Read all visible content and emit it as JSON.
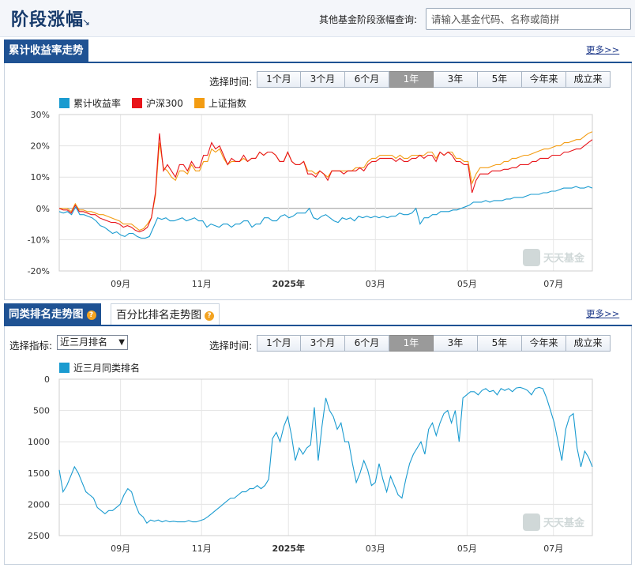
{
  "header": {
    "title": "阶段涨幅",
    "arrow": "↘",
    "search_label": "其他基金阶段涨幅查询:",
    "search_placeholder": "请输入基金代码、名称或简拼"
  },
  "section1": {
    "title": "累计收益率走势",
    "more": "更多>>",
    "range_label": "选择时间:",
    "ranges": [
      "1个月",
      "3个月",
      "6个月",
      "1年",
      "3年",
      "5年",
      "今年来",
      "成立来"
    ],
    "active_range": "1年",
    "legend": [
      {
        "name": "累计收益率",
        "color": "#1a9bd0"
      },
      {
        "name": "沪深300",
        "color": "#e8141a"
      },
      {
        "name": "上证指数",
        "color": "#f39c12"
      }
    ],
    "watermark": "天天基金"
  },
  "section2": {
    "tab_active": "同类排名走势图",
    "tab_inactive": "百分比排名走势图",
    "more": "更多>>",
    "indicator_label": "选择指标:",
    "indicator_value": "近三月排名",
    "range_label": "选择时间:",
    "ranges": [
      "1个月",
      "3个月",
      "6个月",
      "1年",
      "3年",
      "5年",
      "今年来",
      "成立来"
    ],
    "active_range": "1年",
    "legend": [
      {
        "name": "近三月同类排名",
        "color": "#1a9bd0"
      }
    ],
    "watermark": "天天基金"
  },
  "chart_data": [
    {
      "type": "line",
      "x_ticks": [
        "09月",
        "11月",
        "2025年",
        "03月",
        "05月",
        "07月"
      ],
      "ylim": [
        -20,
        30
      ],
      "y_ticks": [
        "30%",
        "20%",
        "10%",
        "0%",
        "-10%",
        "-20%"
      ],
      "series": [
        {
          "name": "累计收益率",
          "color": "#1a9bd0",
          "values": [
            -1,
            -1.5,
            -1,
            -2,
            0.5,
            -2,
            -2,
            -2.5,
            -3,
            -4,
            -5.5,
            -6,
            -7,
            -8,
            -7.5,
            -8.5,
            -9,
            -8,
            -8,
            -9,
            -9.5,
            -9.5,
            -9,
            -6,
            -3,
            -3.5,
            -3,
            -4,
            -4,
            -3.5,
            -3,
            -4,
            -3.5,
            -3,
            -4,
            -4,
            -6,
            -5,
            -5.5,
            -6,
            -5,
            -5,
            -6,
            -5,
            -5,
            -4,
            -4,
            -6,
            -5,
            -5,
            -3,
            -3,
            -4,
            -4,
            -2.5,
            -2,
            -3,
            -2.5,
            -1.5,
            -1.5,
            -1.5,
            0,
            -3,
            -3.5,
            -2.5,
            -2,
            -3,
            -4,
            -4.5,
            -3,
            -3.5,
            -3,
            -4,
            -2.5,
            -3,
            -2.5,
            -3,
            -2.5,
            -3,
            -2.5,
            -3,
            -2.5,
            -2.5,
            -1.5,
            -2,
            -2,
            -1.5,
            0,
            -5,
            -3,
            -3,
            -2,
            -2,
            -1,
            -1,
            -1,
            -0.5,
            -0.5,
            0,
            0.5,
            1,
            2,
            2,
            2,
            2.5,
            2,
            2.5,
            2.5,
            2.5,
            3,
            3,
            3.5,
            3.5,
            3.5,
            4,
            4.5,
            4.5,
            4.5,
            5,
            5,
            5.5,
            5.5,
            6,
            6.5,
            6.5,
            6.5,
            7,
            6.5,
            6.5,
            7,
            6.5
          ]
        },
        {
          "name": "沪深300",
          "color": "#e8141a",
          "values": [
            0,
            -0.5,
            -0.5,
            -1.5,
            1,
            -1,
            -1,
            -1.5,
            -2,
            -2,
            -3,
            -3.5,
            -4,
            -4.5,
            -4.5,
            -5,
            -6,
            -5.5,
            -6,
            -7,
            -7.5,
            -7,
            -6,
            -3,
            5,
            24,
            12,
            14,
            12,
            10,
            14,
            14,
            12,
            15,
            13,
            13,
            17,
            17,
            21,
            19,
            20,
            17,
            14,
            16,
            15,
            15,
            17,
            15,
            16,
            16,
            18,
            17,
            18,
            18,
            17,
            15,
            15,
            18,
            15,
            14,
            14,
            15,
            11,
            11,
            10,
            12,
            11,
            9,
            12,
            12,
            12,
            11,
            12,
            12,
            12,
            13,
            12,
            14,
            15,
            15,
            16,
            16,
            16,
            16,
            15,
            16,
            15,
            15,
            16,
            16,
            17,
            16,
            17,
            17,
            15,
            18,
            17,
            18,
            17,
            15,
            15,
            14,
            14,
            5,
            9,
            11,
            11,
            11,
            12,
            12,
            12,
            12.5,
            12.5,
            13,
            13,
            14,
            14,
            14,
            15,
            15,
            16,
            16,
            16,
            17,
            17,
            17,
            18,
            18,
            18.5,
            19,
            19,
            20,
            21,
            22
          ]
        },
        {
          "name": "上证指数",
          "color": "#f39c12",
          "values": [
            0,
            0,
            0,
            -1,
            1.5,
            -0.5,
            -0.5,
            -1,
            -1,
            -1.5,
            -2,
            -2,
            -2.5,
            -3,
            -3.5,
            -4,
            -5,
            -5,
            -5,
            -6,
            -7,
            -6.5,
            -5,
            -3,
            4,
            21,
            13,
            12,
            10,
            9,
            12,
            12,
            11,
            14,
            12,
            12,
            15,
            15,
            19,
            18,
            19,
            16,
            14,
            15,
            15,
            15,
            16,
            15,
            16,
            16,
            18,
            17,
            18,
            18,
            17,
            15,
            15,
            18,
            15,
            14,
            14,
            15,
            12,
            12,
            11,
            12,
            11,
            10,
            12,
            12,
            12,
            12,
            12,
            12,
            13,
            13,
            13,
            15,
            16,
            16,
            17,
            17,
            17,
            17,
            16,
            17,
            16,
            16,
            17,
            17,
            17,
            17,
            18,
            18,
            16,
            18,
            17,
            18,
            18,
            16,
            16,
            15,
            15,
            8,
            11,
            13,
            13,
            13,
            13.5,
            14,
            14,
            15,
            15,
            16,
            16,
            16.5,
            17,
            17,
            17.5,
            18,
            18.5,
            19,
            19,
            19.5,
            20,
            20,
            21,
            21,
            21.5,
            22,
            22,
            23,
            24,
            24.5
          ]
        }
      ]
    },
    {
      "type": "line",
      "x_ticks": [
        "09月",
        "11月",
        "2025年",
        "03月",
        "05月",
        "07月"
      ],
      "ylim": [
        0,
        2500
      ],
      "y_reversed": true,
      "y_ticks": [
        "0",
        "500",
        "1000",
        "1500",
        "2000",
        "2500"
      ],
      "series": [
        {
          "name": "近三月同类排名",
          "color": "#1a9bd0",
          "values": [
            1450,
            1800,
            1700,
            1550,
            1400,
            1500,
            1650,
            1800,
            1850,
            1900,
            2050,
            2100,
            2150,
            2100,
            2100,
            2050,
            2000,
            1850,
            1750,
            1800,
            2000,
            2150,
            2200,
            2300,
            2250,
            2270,
            2250,
            2280,
            2260,
            2280,
            2270,
            2280,
            2280,
            2280,
            2260,
            2280,
            2280,
            2260,
            2240,
            2200,
            2150,
            2100,
            2050,
            2000,
            1950,
            1900,
            1900,
            1850,
            1800,
            1800,
            1750,
            1750,
            1700,
            1750,
            1700,
            1600,
            950,
            850,
            1000,
            750,
            600,
            900,
            1300,
            1100,
            1200,
            1100,
            1050,
            450,
            1300,
            750,
            300,
            500,
            600,
            800,
            700,
            1000,
            1000,
            1350,
            1650,
            1500,
            1300,
            1450,
            1700,
            1650,
            1350,
            1600,
            1800,
            1550,
            1700,
            1850,
            1900,
            1600,
            1350,
            1200,
            1100,
            1000,
            1200,
            800,
            700,
            900,
            700,
            550,
            500,
            700,
            500,
            1000,
            300,
            250,
            200,
            200,
            250,
            180,
            150,
            200,
            180,
            250,
            150,
            180,
            150,
            200,
            140,
            130,
            150,
            180,
            250,
            150,
            130,
            150,
            300,
            500,
            700,
            1000,
            1300,
            800,
            600,
            550,
            1100,
            1400,
            1150,
            1250,
            1400
          ]
        }
      ]
    }
  ]
}
